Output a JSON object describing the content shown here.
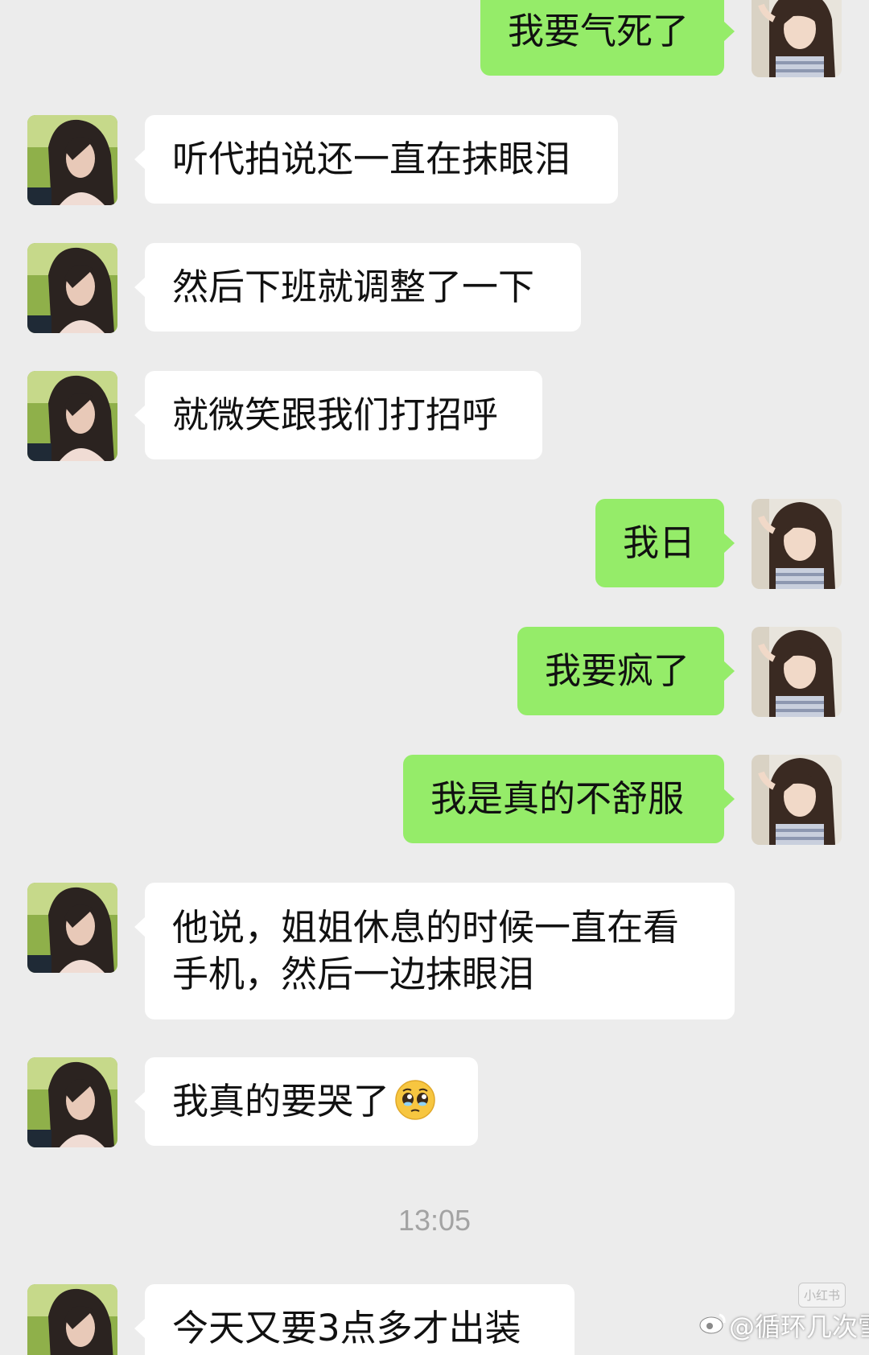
{
  "colors": {
    "background": "#ececec",
    "bubble_in": "#ffffff",
    "bubble_out": "#95ec69",
    "timestamp": "#a3a3a3"
  },
  "messages": [
    {
      "side": "out",
      "text": "我要气死了"
    },
    {
      "side": "in",
      "text": "听代拍说还一直在抹眼泪"
    },
    {
      "side": "in",
      "text": "然后下班就调整了一下"
    },
    {
      "side": "in",
      "text": "就微笑跟我们打招呼"
    },
    {
      "side": "out",
      "text": "我日"
    },
    {
      "side": "out",
      "text": "我要疯了"
    },
    {
      "side": "out",
      "text": "我是真的不舒服"
    },
    {
      "side": "in",
      "line1": "他说，姐姐休息的时候一直在看",
      "line2": "手机，然后一边抹眼泪"
    },
    {
      "side": "in",
      "text": "我真的要哭了",
      "emoji": "pleading-face-emoji"
    },
    {
      "side": "in",
      "text": "今天又要3点多才出装"
    }
  ],
  "timestamp": "13:05",
  "watermarks": {
    "small": "小红书",
    "weibo_handle": "@循环几次雪",
    "weibo_icon": "weibo-icon"
  }
}
